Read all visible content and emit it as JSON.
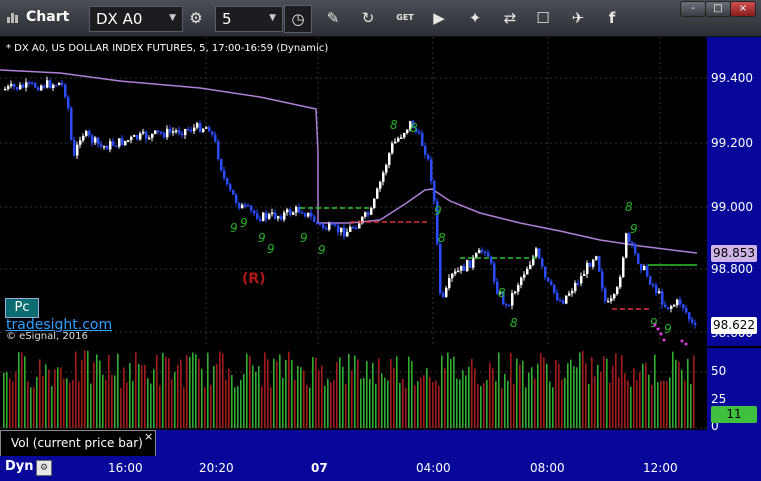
{
  "toolbar": {
    "app_title": "Chart",
    "symbol": "DX A0",
    "interval": "5",
    "icons": [
      "gear-icon",
      "clock-icon",
      "pencil-icon",
      "refresh-icon",
      "get-icon",
      "play-icon",
      "wrench-icon",
      "comment-icon",
      "twitter-icon",
      "facebook-icon"
    ],
    "get_label": "GET"
  },
  "window_buttons": [
    "-",
    "□",
    "×"
  ],
  "chart": {
    "info": "* DX A0, US DOLLAR INDEX FUTURES, 5, 17:00-16:59 (Dynamic)",
    "annotation_r": "(R)",
    "price_ticks": [
      "99.400",
      "99.200",
      "99.000",
      "98.800",
      "98.600"
    ],
    "ma_price_label": "98.853",
    "last_price_label": "98.622",
    "volume_ticks": [
      "50",
      "25",
      "0"
    ],
    "volume_label": "11",
    "time_ticks": [
      "16:00",
      "20:20",
      "07",
      "04:00",
      "08:00",
      "12:00"
    ],
    "brand": "tradesight.com",
    "copyright": "© eSignal, 2016",
    "pc_button": "Pc",
    "study_label": "Vol (current price bar)",
    "close_symbol": "×",
    "dyn_label": "Dyn",
    "colors": {
      "up_bar": "#ffffff",
      "down_bar": "#2a4cff",
      "ma_line": "#b07fd8",
      "td_count": "#26b026",
      "vol_up": "#2fae2f",
      "vol_down": "#a31a1a"
    },
    "td_counts": [
      "8",
      "8",
      "8",
      "9",
      "9",
      "9",
      "9",
      "9",
      "9",
      "9",
      "8",
      "8",
      "8",
      "9",
      "9",
      "9"
    ]
  }
}
